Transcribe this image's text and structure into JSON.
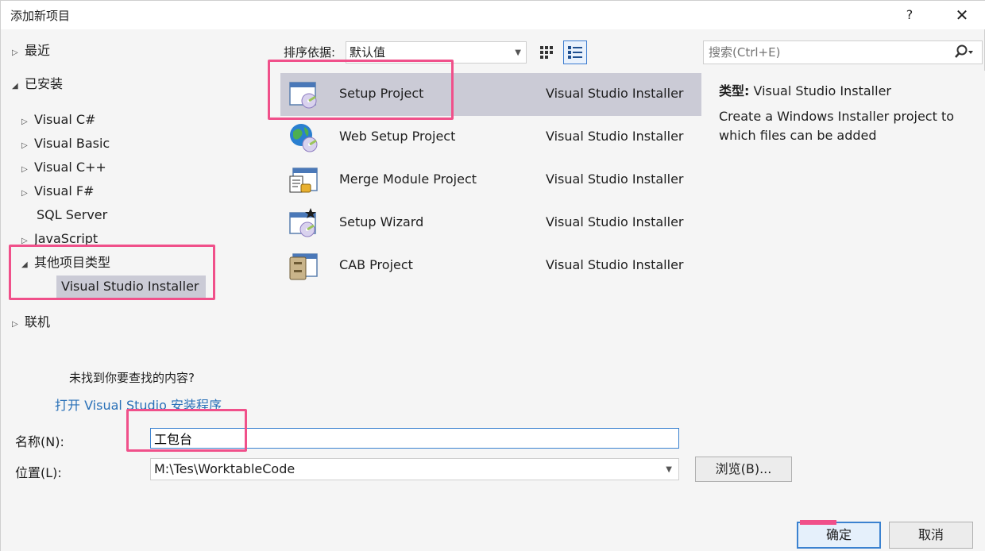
{
  "window": {
    "title": "添加新项目",
    "help_label": "?",
    "close_label": "✕"
  },
  "nav": {
    "recent": "最近",
    "installed": "已安装",
    "items": [
      "Visual C#",
      "Visual Basic",
      "Visual C++",
      "Visual F#",
      "SQL Server",
      "JavaScript"
    ],
    "other_types": "其他项目类型",
    "selected": "Visual Studio Installer",
    "online": "联机",
    "not_found": "未找到你要查找的内容?",
    "open_installer": "打开 Visual Studio 安装程序"
  },
  "toolbar": {
    "sort_label": "排序依据:",
    "sort_value": "默认值"
  },
  "search": {
    "placeholder": "搜索(Ctrl+E)"
  },
  "templates": [
    {
      "name": "Setup Project",
      "lang": "Visual Studio Installer",
      "icon": "setup-project-icon"
    },
    {
      "name": "Web Setup Project",
      "lang": "Visual Studio Installer",
      "icon": "web-setup-icon"
    },
    {
      "name": "Merge Module Project",
      "lang": "Visual Studio Installer",
      "icon": "merge-module-icon"
    },
    {
      "name": "Setup Wizard",
      "lang": "Visual Studio Installer",
      "icon": "setup-wizard-icon"
    },
    {
      "name": "CAB Project",
      "lang": "Visual Studio Installer",
      "icon": "cab-project-icon"
    }
  ],
  "description": {
    "type_label": "类型:",
    "type_value": "Visual Studio Installer",
    "text": "Create a Windows Installer project to which files can be added"
  },
  "form": {
    "name_label": "名称(N):",
    "name_value": "工包台",
    "location_label": "位置(L):",
    "location_value": "M:\\Tes\\WorktableCode",
    "browse_label": "浏览(B)...",
    "ok_label": "确定",
    "cancel_label": "取消"
  },
  "colors": {
    "selection": "#cbcbd6",
    "accent": "#3b82d0",
    "annotation": "#f0508a",
    "link": "#2a71b8"
  }
}
